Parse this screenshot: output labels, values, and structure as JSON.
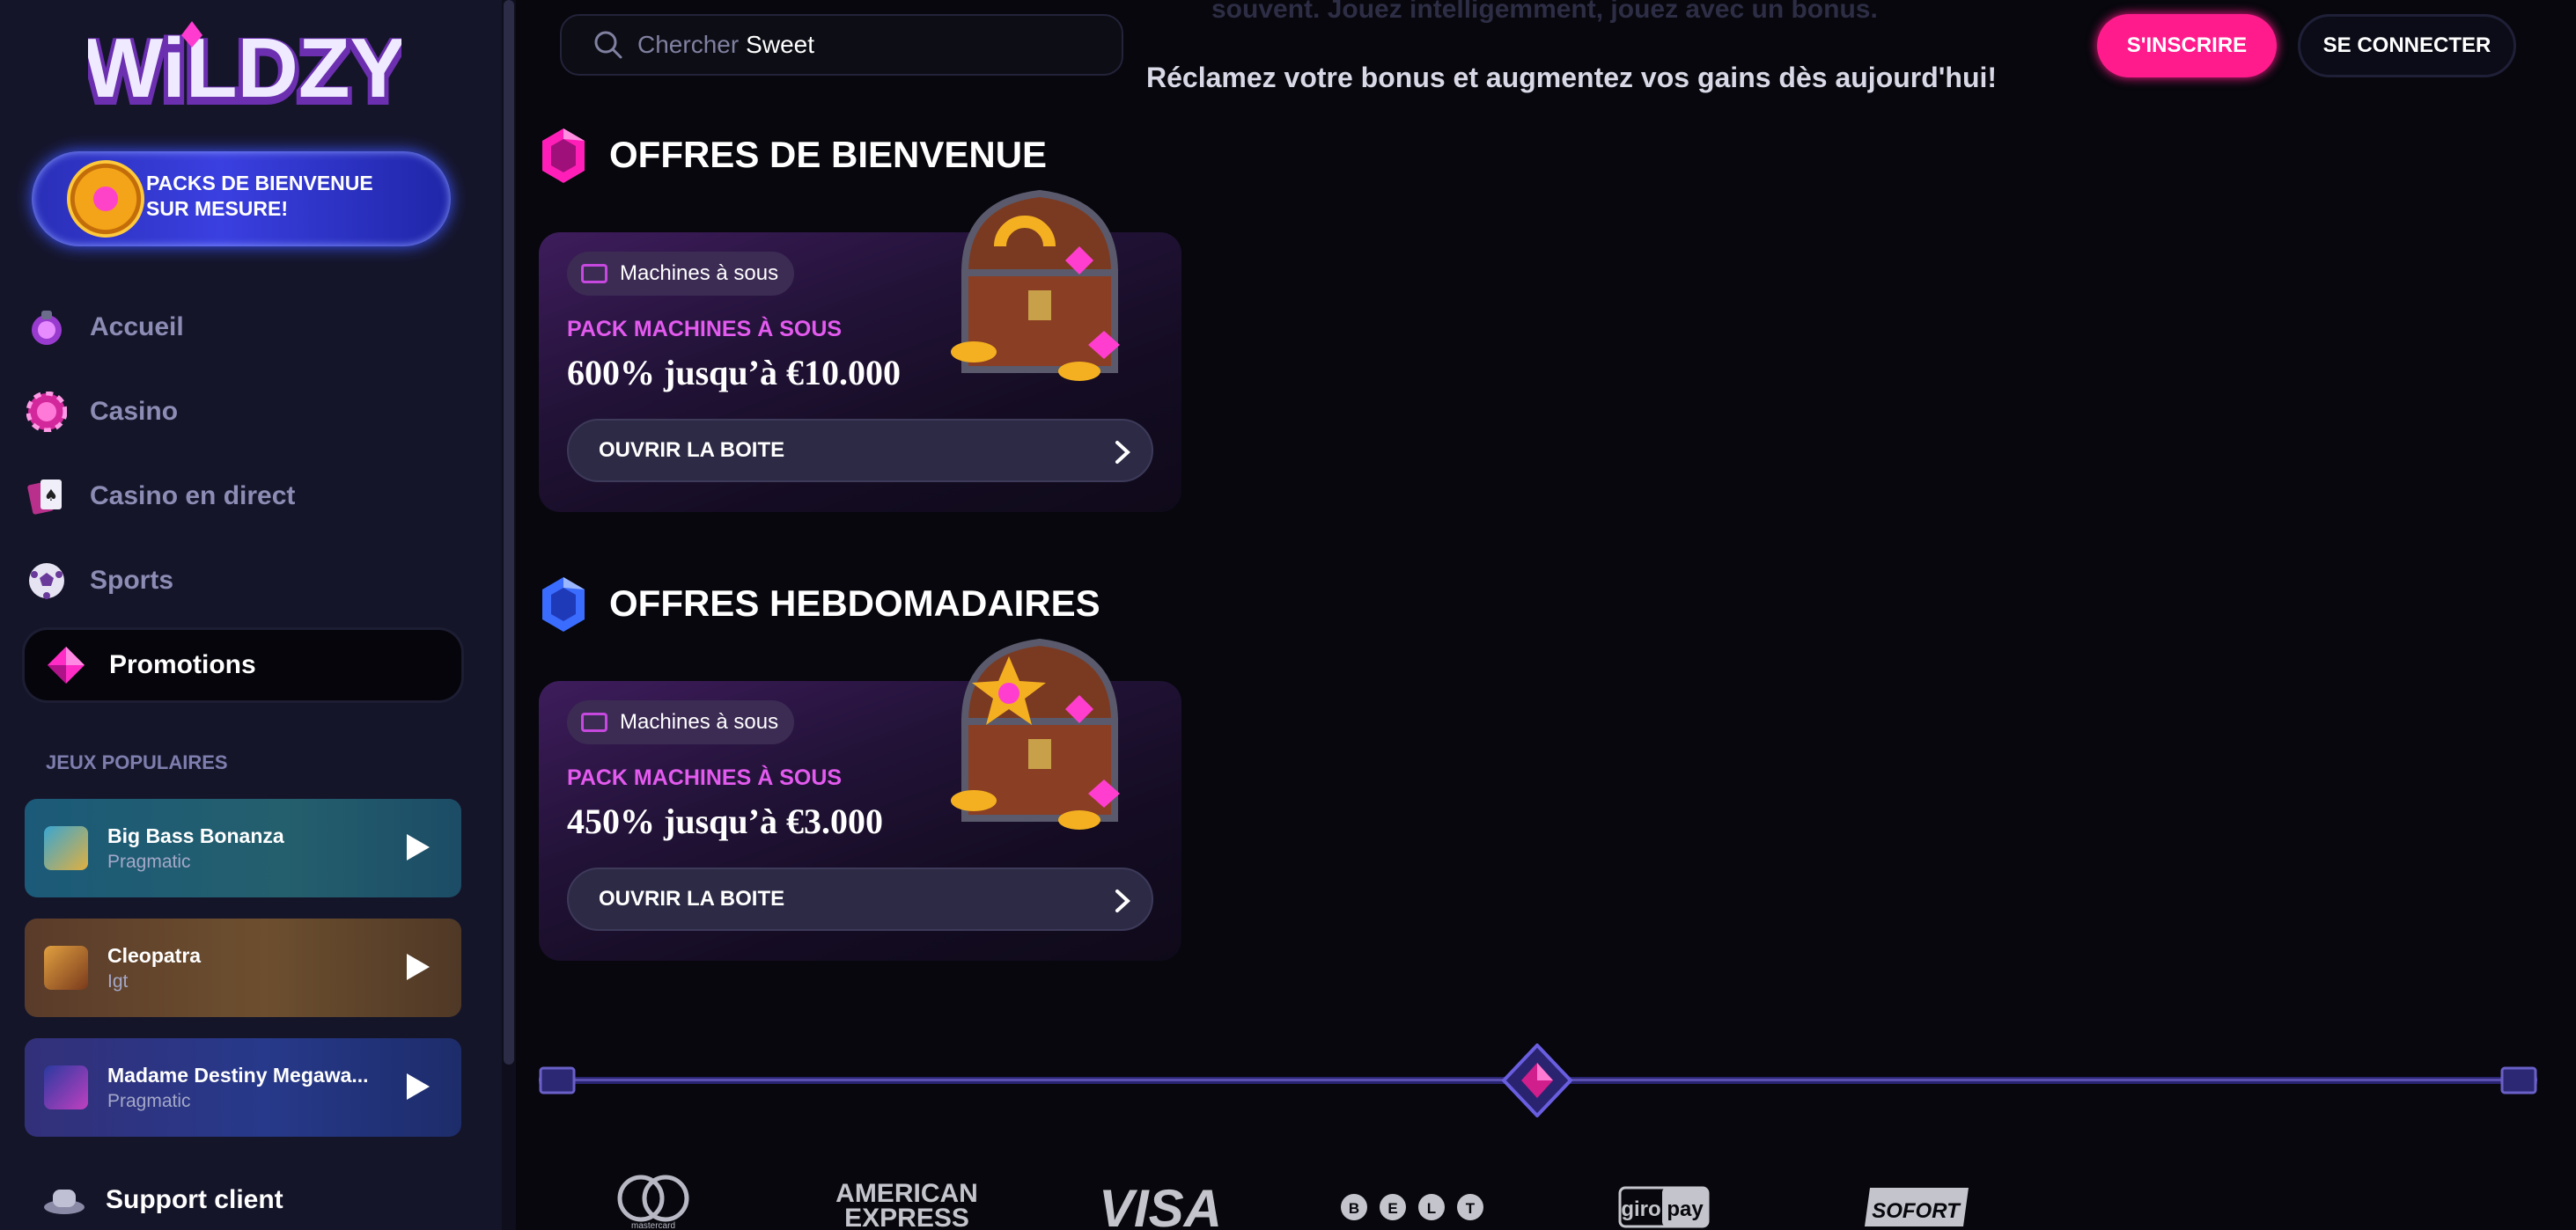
{
  "sidebar": {
    "logo_text": "WiLDZY",
    "banner": "PACKS DE BIENVENUE SUR MESURE!",
    "nav": [
      {
        "label": "Accueil",
        "icon": "purple-potion-icon"
      },
      {
        "label": "Casino",
        "icon": "casino-chip-icon"
      },
      {
        "label": "Casino en direct",
        "icon": "playing-cards-icon"
      },
      {
        "label": "Sports",
        "icon": "soccer-ball-icon"
      },
      {
        "label": "Promotions",
        "icon": "pink-diamond-icon",
        "active": true
      }
    ],
    "popular_heading": "JEUX POPULAIRES",
    "games": [
      {
        "title": "Big Bass Bonanza",
        "provider": "Pragmatic"
      },
      {
        "title": "Cleopatra",
        "provider": "Igt"
      },
      {
        "title": "Madame Destiny Megawa...",
        "provider": "Pragmatic"
      }
    ],
    "support": "Support client"
  },
  "header": {
    "search_placeholder": "Chercher",
    "search_value": "Sweet",
    "faded_text": "souvent. Jouez intelligemment, jouez avec un bonus.",
    "subtitle": "Réclamez votre bonus et augmentez vos gains dès aujourd'hui!",
    "register": "S'INSCRIRE",
    "login": "SE CONNECTER"
  },
  "sections": [
    {
      "title": "OFFRES DE BIENVENUE",
      "card": {
        "tag": "Machines à sous",
        "kind": "PACK MACHINES À SOUS",
        "offer": "600% jusqu’à €10.000",
        "button": "OUVRIR LA BOITE"
      }
    },
    {
      "title": "OFFRES HEBDOMADAIRES",
      "card": {
        "tag": "Machines à sous",
        "kind": "PACK MACHINES À SOUS",
        "offer": "450% jusqu’à €3.000",
        "button": "OUVRIR LA BOITE"
      }
    }
  ],
  "payments": {
    "mastercard": "mastercard",
    "amex_1": "AMERICAN",
    "amex_2": "EXPRESS",
    "visa": "VISA",
    "crypto": [
      "B",
      "E",
      "L",
      "T"
    ],
    "giropay_1": "giro",
    "giropay_2": "pay",
    "sofort": "SOFORT"
  },
  "colors": {
    "accent_pink": "#ff1b8c",
    "sidebar_bg": "#15152a",
    "page_bg": "#07070d",
    "tag_purple": "#e35aef"
  }
}
